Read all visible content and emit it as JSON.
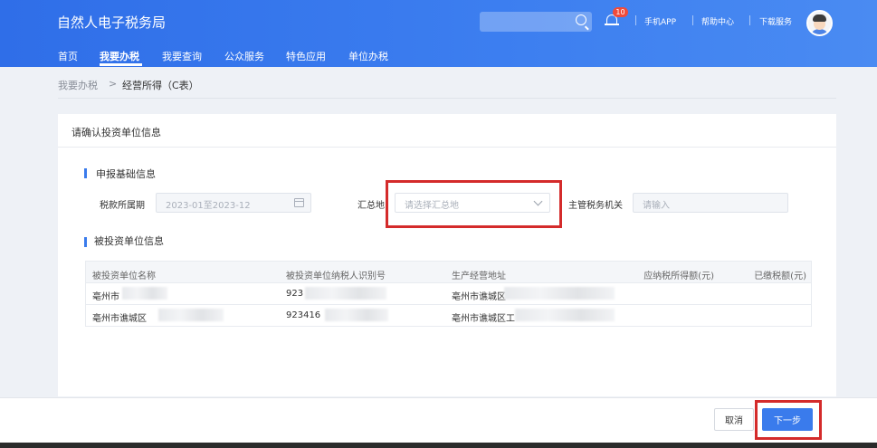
{
  "header": {
    "brand": "自然人电子税务局",
    "search_icon": "search-icon",
    "notification_count": "10",
    "links": [
      "手机APP",
      "帮助中心",
      "下载服务"
    ]
  },
  "nav": {
    "items": [
      "首页",
      "我要办税",
      "我要查询",
      "公众服务",
      "特色应用",
      "单位办税"
    ],
    "active": "我要办税"
  },
  "breadcrumb": {
    "root": "我要办税",
    "separator": ">",
    "current": "经营所得（C表）"
  },
  "card": {
    "title": "请确认投资单位信息",
    "basic_section": {
      "title": "申报基础信息",
      "period_label": "税款所属期",
      "period_value": "2023-01至2023-12",
      "summary_place_label": "汇总地",
      "summary_place_placeholder": "请选择汇总地",
      "tax_authority_label": "主管税务机关",
      "tax_authority_placeholder": "请输入"
    },
    "invested_section": {
      "title": "被投资单位信息",
      "columns": [
        "被投资单位名称",
        "被投资单位纳税人识别号",
        "生产经营地址",
        "应纳税所得额(元)",
        "已缴税额(元)"
      ],
      "rows": [
        {
          "name": "亳州市",
          "tax_id": "923",
          "address": "亳州市谯城区",
          "taxable_income": "",
          "tax_paid": ""
        },
        {
          "name": "亳州市谯城区",
          "tax_id": "923416",
          "address": "亳州市谯城区工",
          "taxable_income": "",
          "tax_paid": ""
        }
      ]
    }
  },
  "footer": {
    "cancel_label": "取消",
    "next_label": "下一步"
  },
  "colors": {
    "primary": "#3a7bec",
    "highlight": "#d42b2b",
    "money": "#e9662c"
  }
}
